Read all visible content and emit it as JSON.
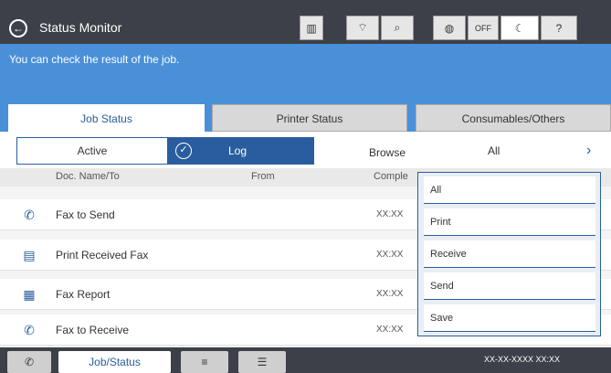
{
  "header": {
    "back_icon": "back-arrow-icon",
    "title": "Status Monitor",
    "status_icons": [
      {
        "name": "printer-status-icon",
        "glyph": "▥"
      },
      {
        "name": "wifi-status-icon",
        "glyph": "⌔"
      },
      {
        "name": "wifi-direct-icon",
        "glyph": "⌕"
      },
      {
        "name": "nfc-icon",
        "glyph": "◍"
      },
      {
        "name": "off-mode-icon",
        "glyph": "OFF"
      },
      {
        "name": "sleep-icon",
        "glyph": "☾"
      },
      {
        "name": "help-icon",
        "glyph": "?"
      }
    ]
  },
  "banner": {
    "message": "You can check the result of the job."
  },
  "tabs": [
    {
      "label": "Job Status",
      "active": true
    },
    {
      "label": "Printer Status",
      "active": false
    },
    {
      "label": "Consumables/Others",
      "active": false
    }
  ],
  "toolbar": {
    "active_label": "Active",
    "log_label": "Log",
    "browse_label": "Browse",
    "browse_value": "All",
    "chevron": "›"
  },
  "columns": {
    "doc": "Doc. Name/To",
    "from": "From",
    "complete": "Comple"
  },
  "rows": [
    {
      "icon": "fax-send-icon",
      "glyph": "✆",
      "name": "Fax to Send",
      "time": "XX:XX"
    },
    {
      "icon": "print-received-fax-icon",
      "glyph": "▤",
      "name": "Print Received Fax",
      "time": "XX:XX"
    },
    {
      "icon": "fax-report-icon",
      "glyph": "▦",
      "name": "Fax Report",
      "time": "XX:XX"
    },
    {
      "icon": "fax-receive-icon",
      "glyph": "✆",
      "name": "Fax to Receive",
      "time": "XX:XX"
    }
  ],
  "dropdown": {
    "options": [
      "All",
      "Print",
      "Receive",
      "Send",
      "Save"
    ]
  },
  "bottom": {
    "left_icon": "fax-icon",
    "jobstatus_label": "Job/Status",
    "stop_icon": "queue-icon",
    "menu_icon": "menu-icon",
    "datetime": "XX-XX-XXXX XX:XX"
  },
  "colors": {
    "accent": "#2a5d9f",
    "banner": "#4a90d9",
    "titlebar": "#3d4048"
  }
}
